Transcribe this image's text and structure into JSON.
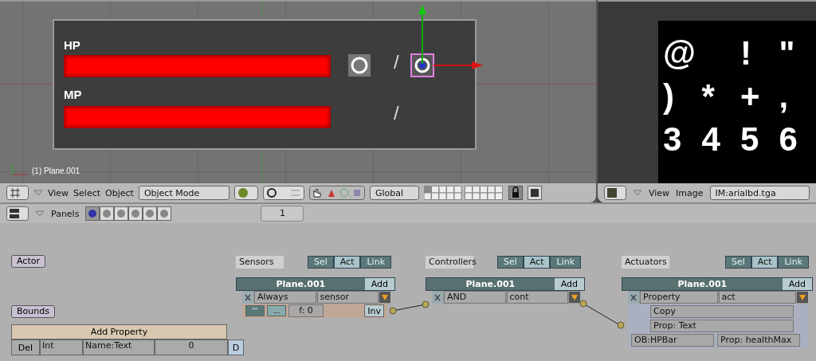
{
  "viewport": {
    "labels": [
      "HP",
      "MP"
    ],
    "slashes": [
      "/",
      "/"
    ],
    "object_info": "(1) Plane.001"
  },
  "image_view": {
    "glyph_rows": [
      [
        "@",
        "!",
        "\""
      ],
      [
        ")",
        "*",
        "+",
        ","
      ],
      [
        "3",
        "4",
        "5",
        "6"
      ]
    ]
  },
  "view3d_header": {
    "menus": [
      "View",
      "Select",
      "Object"
    ],
    "mode": "Object Mode",
    "orientation": "Global"
  },
  "image_header": {
    "menus": [
      "View",
      "Image"
    ],
    "image": "IM:arialbd.tga"
  },
  "buttons_header": {
    "label": "Panels",
    "tabs": [
      {
        "selected": true
      },
      {
        "selected": false
      },
      {
        "selected": false
      },
      {
        "selected": false
      },
      {
        "selected": false
      },
      {
        "selected": false
      }
    ],
    "frame": "1"
  },
  "logic": {
    "actor": "Actor",
    "bounds": "Bounds",
    "add_property": "Add Property",
    "property": {
      "del": "Del",
      "type": "Int",
      "name": "Name:Text",
      "value": "0",
      "debug": "D"
    },
    "columns": [
      {
        "kind": "sensor",
        "title": "Sensors",
        "filters": [
          {
            "label": "Sel",
            "selected": false
          },
          {
            "label": "Act",
            "selected": true
          },
          {
            "label": "Link",
            "selected": false
          }
        ],
        "object": "Plane.001",
        "add": "Add",
        "type": "Always",
        "name": "sensor",
        "pulse_on": "'''",
        "pulse_off": "...",
        "freq": "f: 0",
        "invert": "Inv"
      },
      {
        "kind": "controller",
        "title": "Controllers",
        "filters": [
          {
            "label": "Sel",
            "selected": false
          },
          {
            "label": "Act",
            "selected": true
          },
          {
            "label": "Link",
            "selected": false
          }
        ],
        "object": "Plane.001",
        "add": "Add",
        "type": "AND",
        "name": "cont"
      },
      {
        "kind": "actuator",
        "title": "Actuators",
        "filters": [
          {
            "label": "Sel",
            "selected": false
          },
          {
            "label": "Act",
            "selected": true
          },
          {
            "label": "Link",
            "selected": false
          }
        ],
        "object": "Plane.001",
        "add": "Add",
        "type": "Property",
        "name": "act",
        "mode": "Copy",
        "prop": "Prop: Text",
        "from_object": "OB:HPBar",
        "from_prop": "Prop: healthMax"
      }
    ]
  }
}
